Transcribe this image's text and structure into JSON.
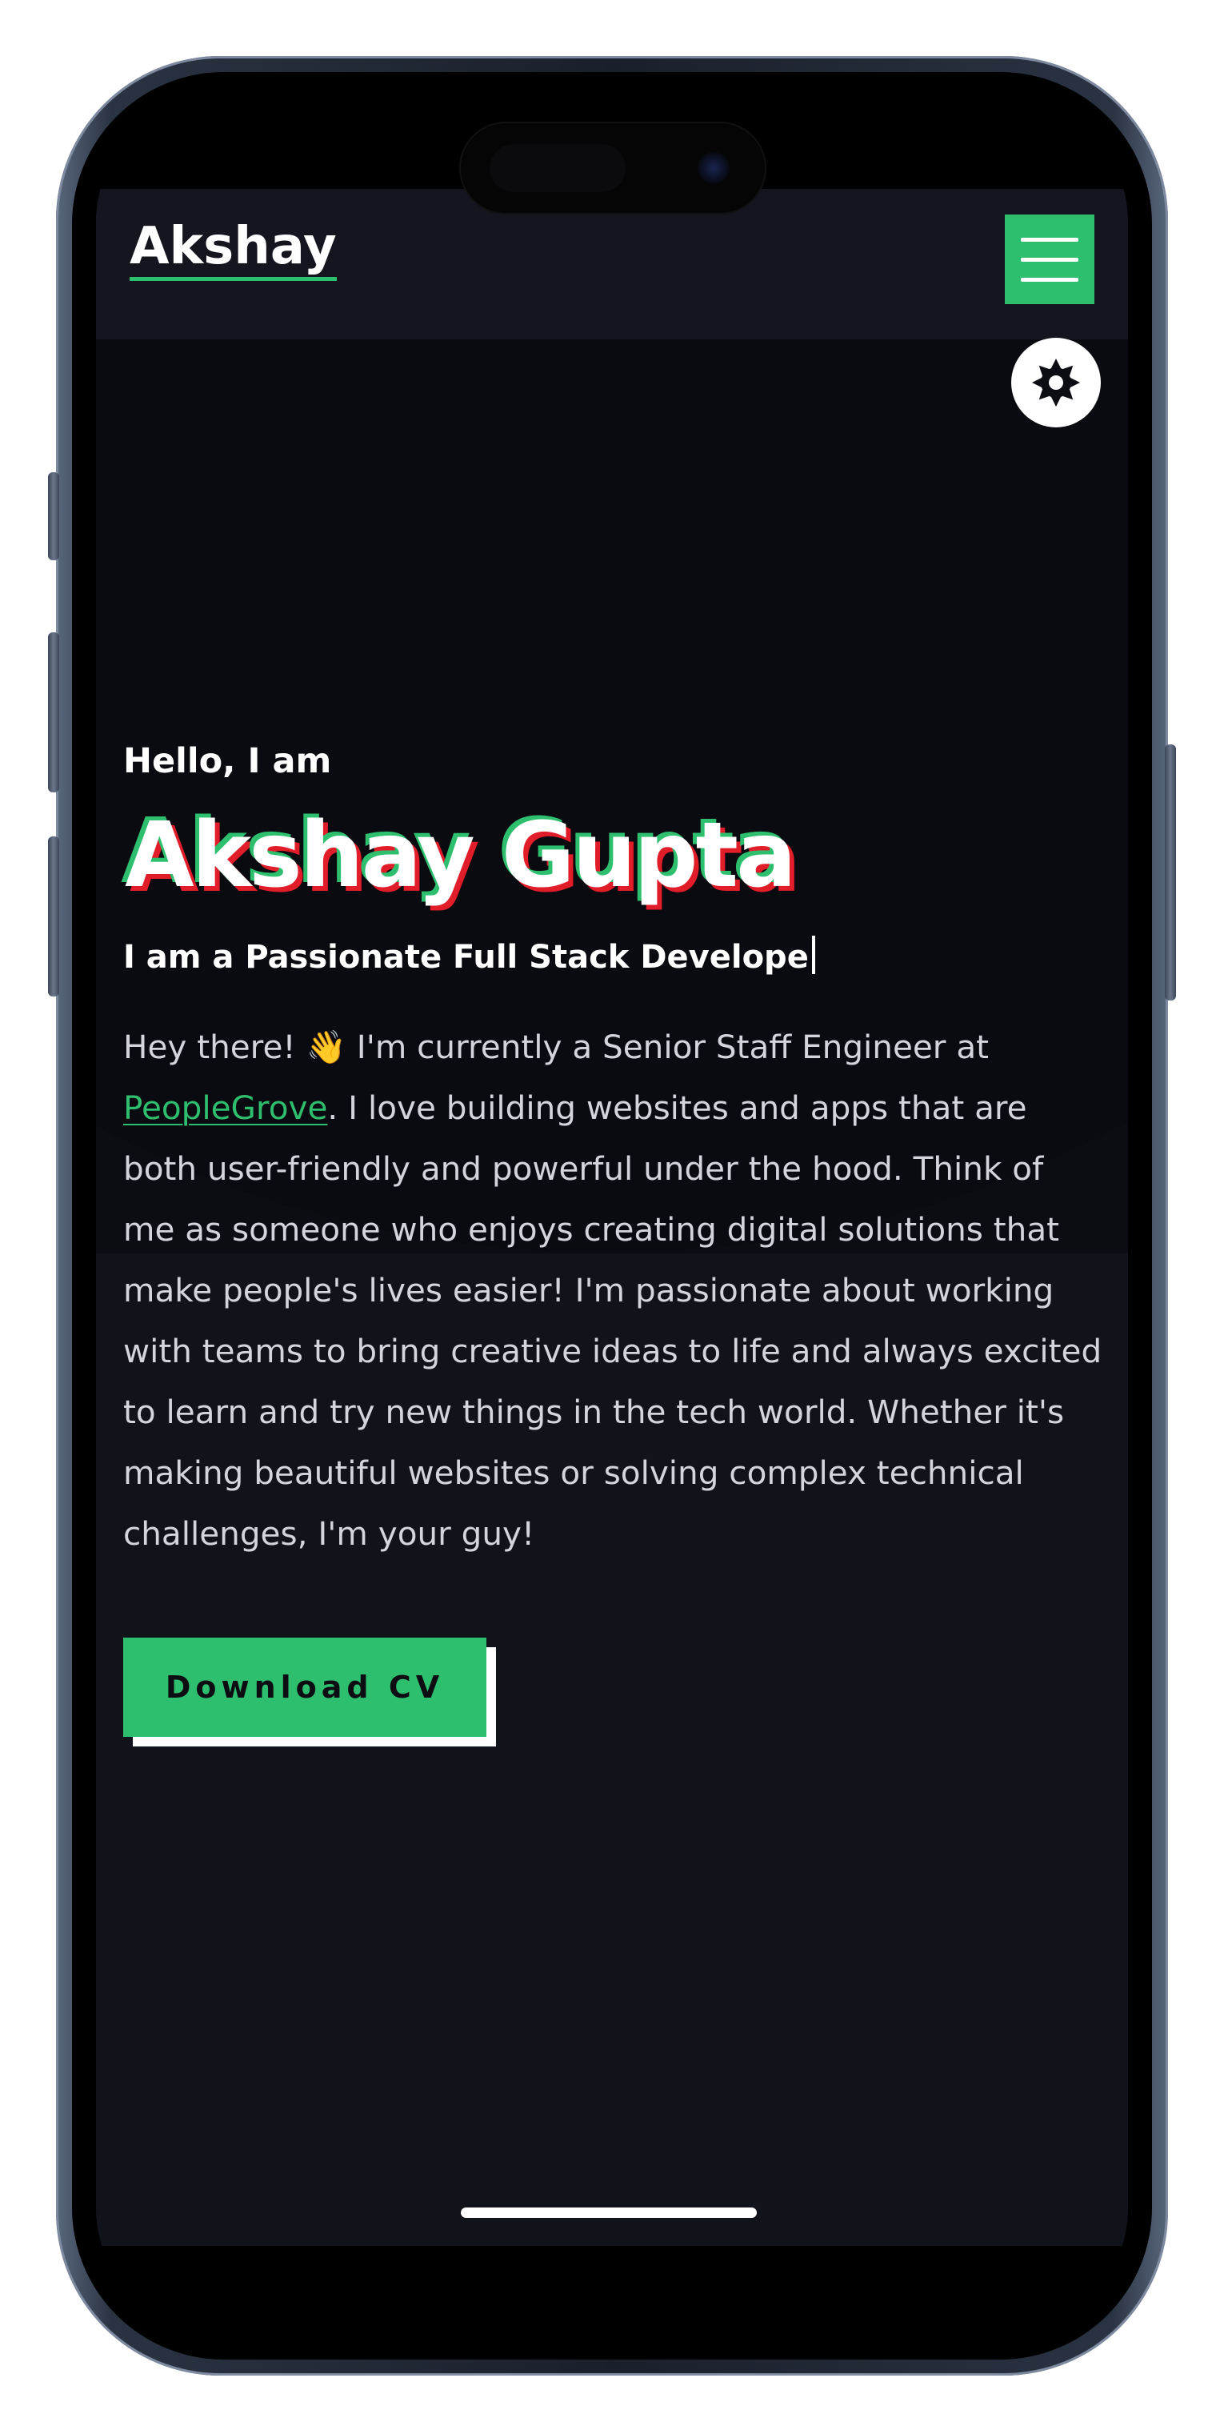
{
  "navbar": {
    "brand": "Akshay",
    "menu_icon": "hamburger-menu-icon",
    "theme_icon": "sun-icon",
    "accent_color": "#2ebf6e"
  },
  "hero": {
    "greeting": "Hello, I am",
    "name": "Akshay Gupta",
    "tagline": "I am a Passionate Full Stack Develope",
    "bio_intro": "Hey there! 👋 I'm currently a Senior Staff Engineer at ",
    "bio_link": "PeopleGrove",
    "bio_rest": ". I love building websites and apps that are both user-friendly and powerful under the hood. Think of me as someone who enjoys creating digital solutions that make people's lives easier! I'm passionate about working with teams to bring creative ideas to life and always excited to learn and try new things in the tech world. Whether it's making beautiful websites or solving complex technical challenges, I'm your guy!",
    "cta_label": "Download CV"
  },
  "colors": {
    "background": "#0c0d13",
    "accent": "#2ebf6e",
    "name_shadow_red": "#e11d2a",
    "text": "#ffffff",
    "body_text": "#d3d5dc"
  }
}
